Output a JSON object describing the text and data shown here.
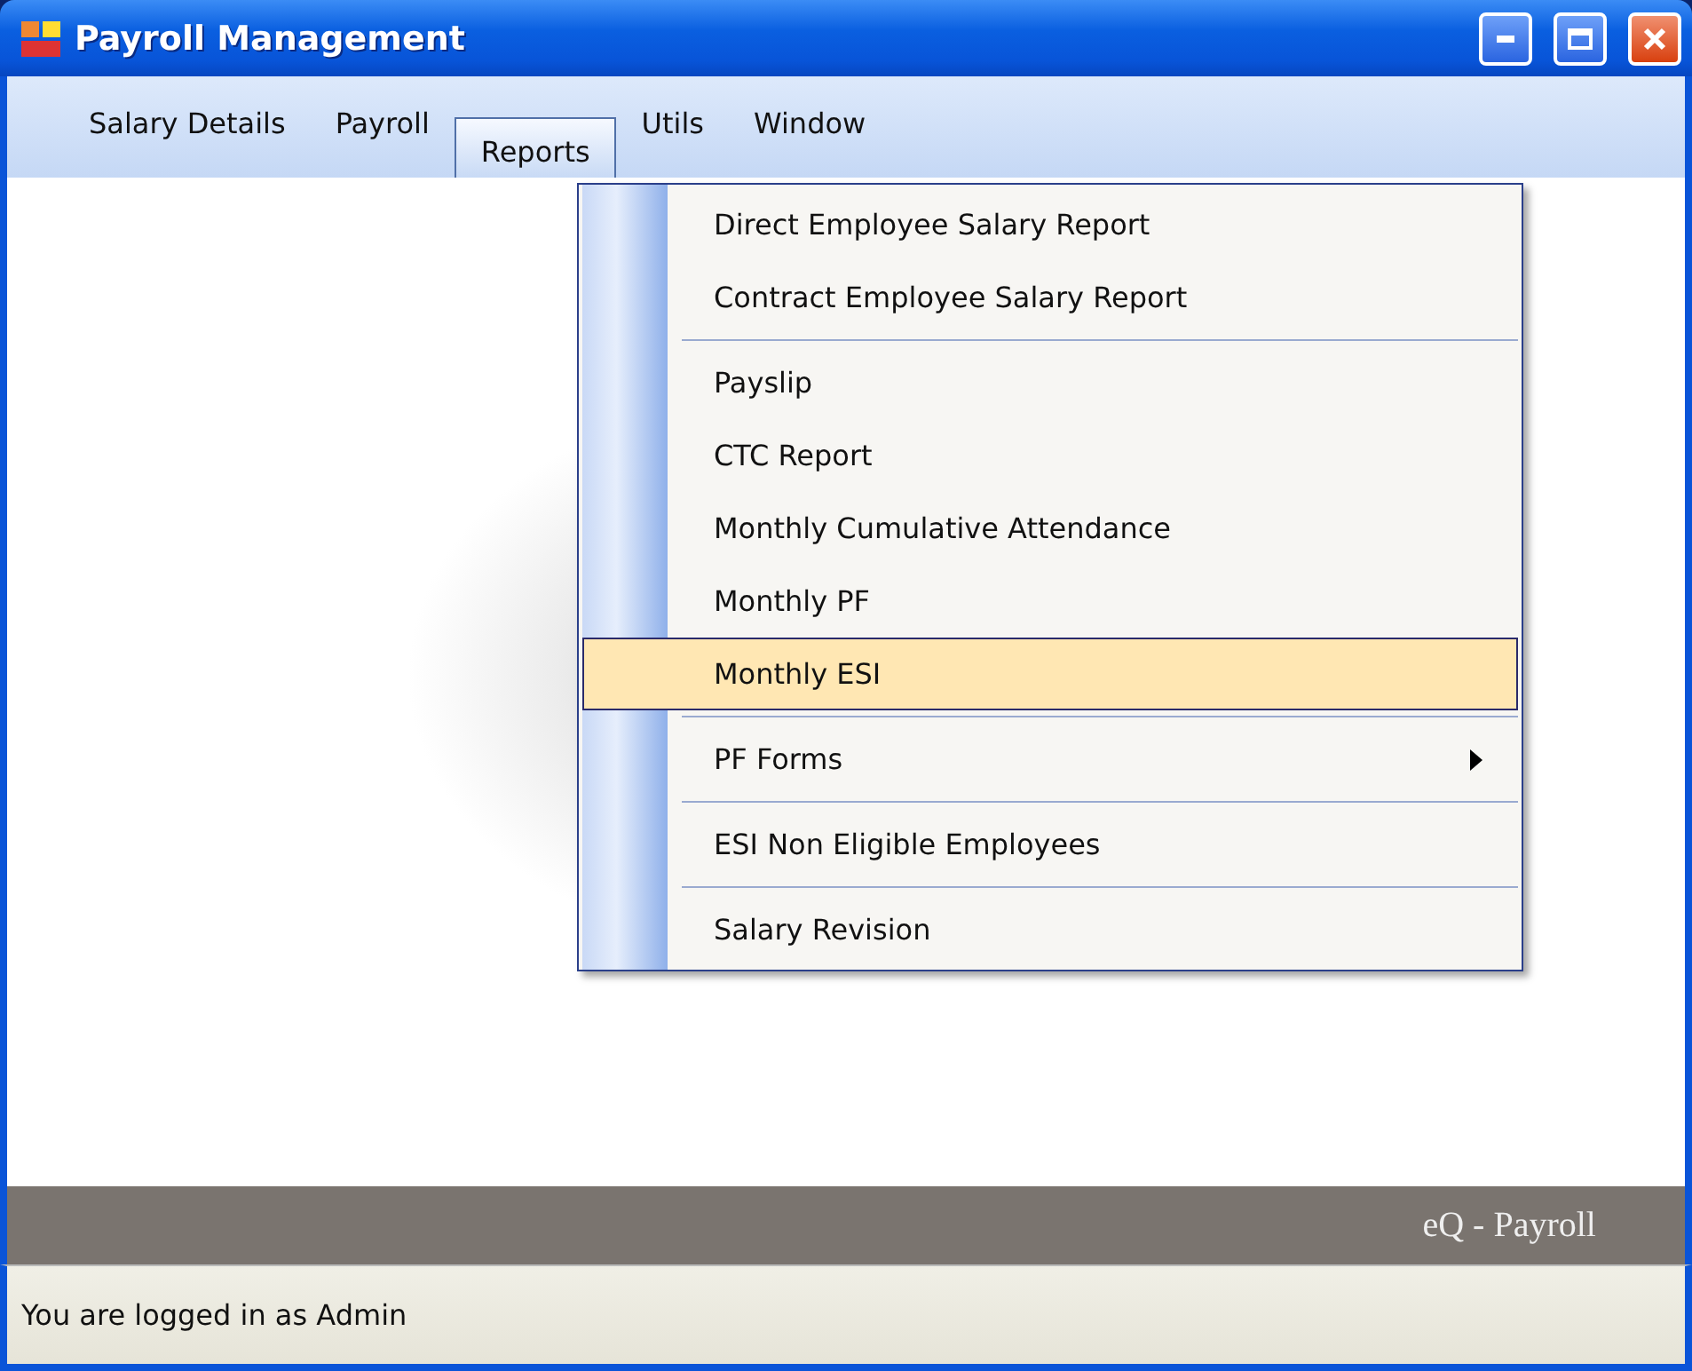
{
  "window": {
    "title": "Payroll Management"
  },
  "menu_bar": [
    {
      "label": "Salary Details",
      "selected": false
    },
    {
      "label": "Payroll",
      "selected": false
    },
    {
      "label": "Reports",
      "selected": true
    },
    {
      "label": "Utils",
      "selected": false
    },
    {
      "label": "Window",
      "selected": false
    }
  ],
  "reports_menu": [
    {
      "kind": "item",
      "label": "Direct Employee Salary Report",
      "selected": false
    },
    {
      "kind": "item",
      "label": "Contract Employee Salary Report",
      "selected": false
    },
    {
      "kind": "separator"
    },
    {
      "kind": "item",
      "label": "Payslip",
      "selected": false
    },
    {
      "kind": "item",
      "label": "CTC Report",
      "selected": false
    },
    {
      "kind": "item",
      "label": "Monthly Cumulative Attendance",
      "selected": false
    },
    {
      "kind": "item",
      "label": "Monthly PF",
      "selected": false
    },
    {
      "kind": "item",
      "label": "Monthly ESI",
      "selected": true
    },
    {
      "kind": "separator"
    },
    {
      "kind": "submenu",
      "label": "PF Forms",
      "selected": false
    },
    {
      "kind": "separator"
    },
    {
      "kind": "item",
      "label": "ESI Non Eligible Employees",
      "selected": false
    },
    {
      "kind": "separator"
    },
    {
      "kind": "item",
      "label": "Salary Revision",
      "selected": false
    }
  ],
  "banner": {
    "brand": "eQ - Payroll"
  },
  "status_bar": {
    "text": "You are logged in as Admin"
  }
}
